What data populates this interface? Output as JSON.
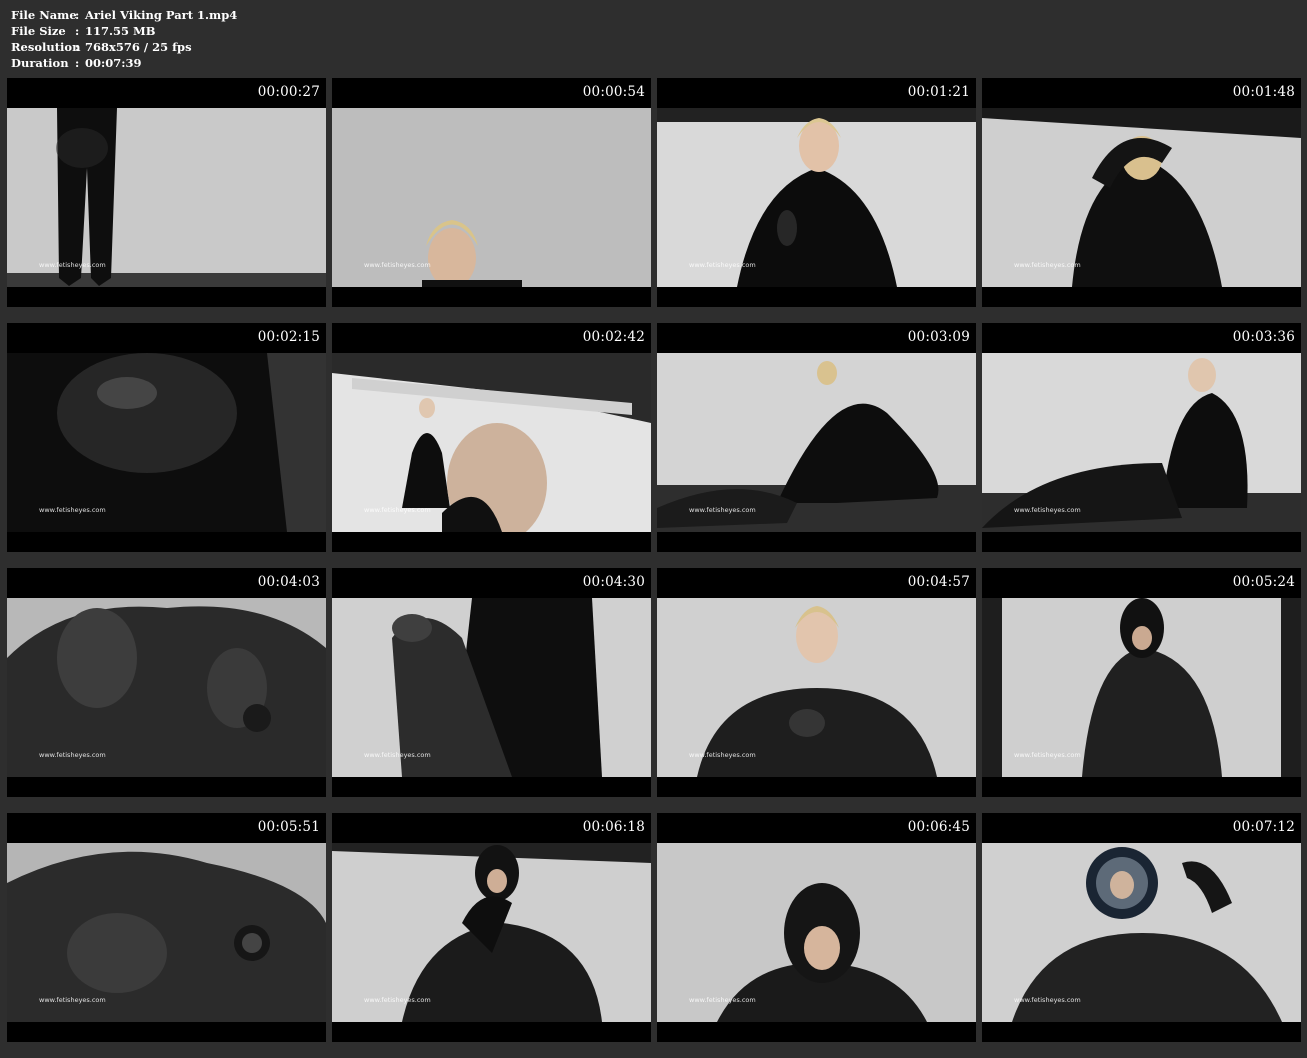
{
  "info": {
    "rows": [
      {
        "key": "File Name",
        "sep": ":",
        "value": "Ariel Viking Part 1.mp4"
      },
      {
        "key": "File Size",
        "sep": ":",
        "value": "117.55 MB"
      },
      {
        "key": "Resolution",
        "sep": ":",
        "value": "768x576 / 25 fps"
      },
      {
        "key": "Duration",
        "sep": ":",
        "value": "00:07:39"
      }
    ]
  },
  "watermark": "www.fetisheyes.com",
  "thumbnails": [
    {
      "timestamp": "00:00:27"
    },
    {
      "timestamp": "00:00:54"
    },
    {
      "timestamp": "00:01:21"
    },
    {
      "timestamp": "00:01:48"
    },
    {
      "timestamp": "00:02:15"
    },
    {
      "timestamp": "00:02:42"
    },
    {
      "timestamp": "00:03:09"
    },
    {
      "timestamp": "00:03:36"
    },
    {
      "timestamp": "00:04:03"
    },
    {
      "timestamp": "00:04:30"
    },
    {
      "timestamp": "00:04:57"
    },
    {
      "timestamp": "00:05:24"
    },
    {
      "timestamp": "00:05:51"
    },
    {
      "timestamp": "00:06:18"
    },
    {
      "timestamp": "00:06:45"
    },
    {
      "timestamp": "00:07:12"
    }
  ]
}
